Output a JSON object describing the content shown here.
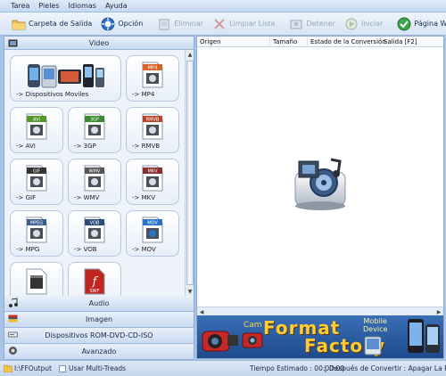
{
  "menu": [
    "Tarea",
    "Pieles",
    "Idiomas",
    "Ayuda"
  ],
  "toolbar": {
    "output_folder": "Carpeta de Salida",
    "option": "Opción",
    "remove": "Eliminar",
    "clear_list": "Limpiar Lista",
    "stop": "Detener",
    "start": "Iniciar",
    "homepage": "Página Web"
  },
  "sections": {
    "video": "Video",
    "audio": "Audio",
    "image": "Imagen",
    "rom": "Dispositivos ROM-DVD-CD-ISO",
    "advanced": "Avanzado"
  },
  "tiles": [
    {
      "label": "-> Dispositivos Moviles",
      "icon": "mobile-devices-icon"
    },
    {
      "label": "-> MP4",
      "icon": "mp4-icon",
      "badge": "MP4",
      "color": "#d8662a"
    },
    {
      "label": "-> AVI",
      "icon": "avi-icon",
      "badge": "AVI",
      "color": "#4f9a2a"
    },
    {
      "label": "-> 3GP",
      "icon": "3gp-icon",
      "badge": "3GP",
      "color": "#3c8a2f"
    },
    {
      "label": "-> RMVB",
      "icon": "rmvb-icon",
      "badge": "RMVB",
      "color": "#b8452c"
    },
    {
      "label": "-> GIF",
      "icon": "gif-icon",
      "badge": "GIF",
      "color": "#333333"
    },
    {
      "label": "-> WMV",
      "icon": "wmv-icon",
      "badge": "WMV",
      "color": "#555555"
    },
    {
      "label": "-> MKV",
      "icon": "mkv-icon",
      "badge": "MKV",
      "color": "#8a2f2f"
    },
    {
      "label": "-> MPG",
      "icon": "mpg-icon",
      "badge": "MPEG",
      "color": "#3a5f8f"
    },
    {
      "label": "-> VOB",
      "icon": "vob-icon",
      "badge": "VOB",
      "color": "#2c4a7a"
    },
    {
      "label": "-> MOV",
      "icon": "mov-icon",
      "badge": "MOV",
      "color": "#2a73c9"
    },
    {
      "label": "",
      "icon": "clapperboard-file-icon"
    },
    {
      "label": "",
      "icon": "swf-icon",
      "badge": "SWF",
      "color": "#c0261f"
    }
  ],
  "table": {
    "columns": [
      "Origen",
      "Tamaño",
      "Estado de la Conversión",
      "Salida [F2]"
    ]
  },
  "banner": {
    "cam": "Cam",
    "brand_line1": "Format",
    "brand_line2": "Factory",
    "mobile_line1": "Mobile",
    "mobile_line2": "Device"
  },
  "status": {
    "output_path": "I:\\FFOutput",
    "multithread": "Usar Multi-Treads",
    "time_label": "Tiempo Estimado : 00:00:00",
    "after_convert": "Después de Convertir : Apagar La PC"
  }
}
